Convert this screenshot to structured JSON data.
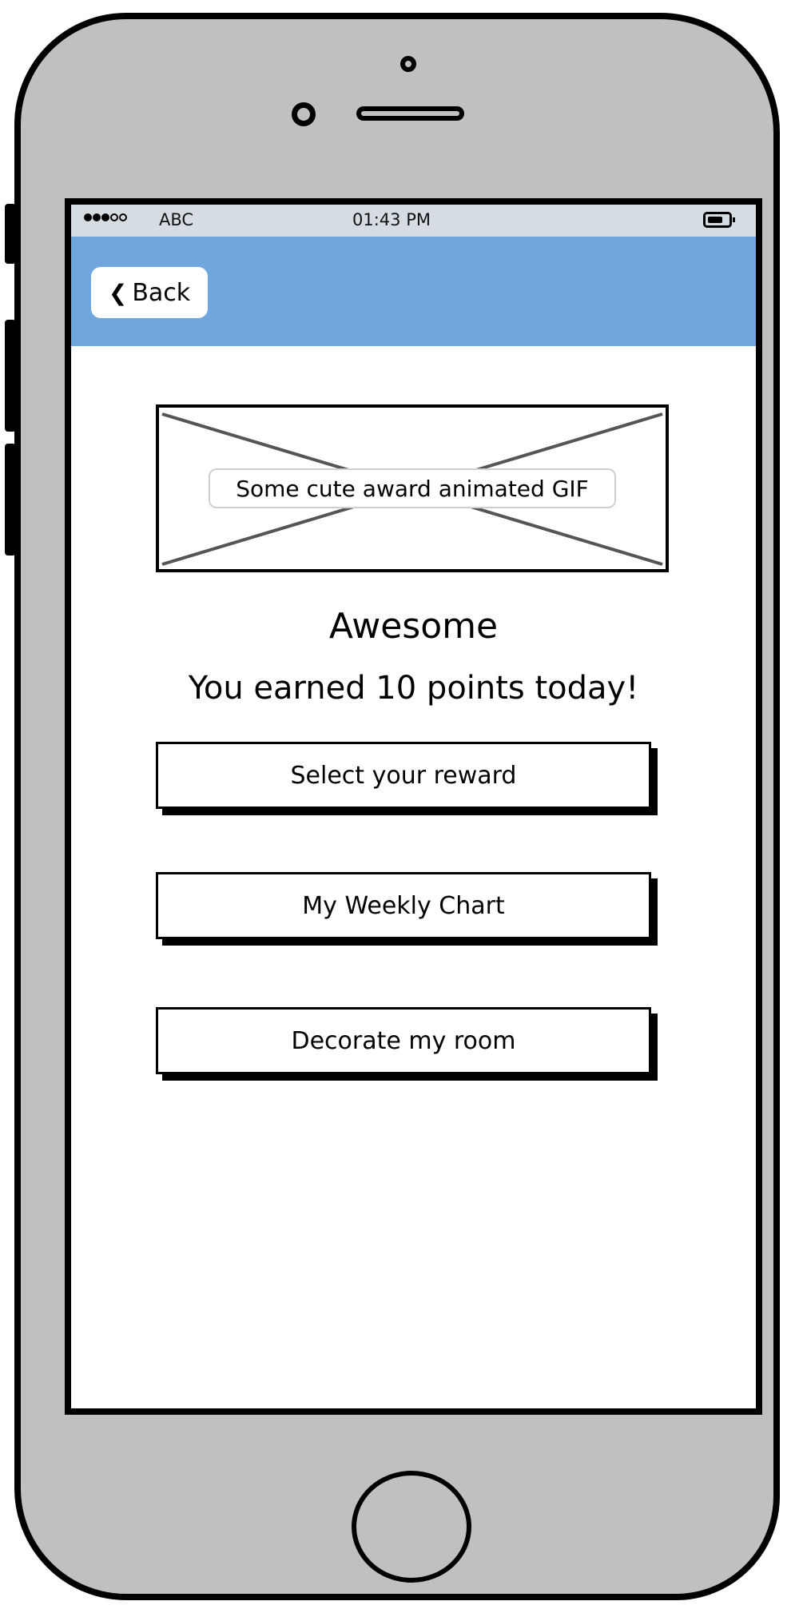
{
  "status_bar": {
    "carrier": "ABC",
    "time": "01:43 PM",
    "signal_bars_filled": 3,
    "signal_bars_total": 5
  },
  "nav": {
    "back_label": "Back",
    "back_icon": "chevron-left-icon"
  },
  "award_image": {
    "caption": "Some cute award animated GIF"
  },
  "main": {
    "title": "Awesome",
    "subtitle": "You earned 10 points today!"
  },
  "actions": {
    "select_reward": "Select your reward",
    "weekly_chart": "My Weekly Chart",
    "decorate_room": "Decorate my room"
  },
  "colors": {
    "nav_bar": "#6fa6dc",
    "status_bar": "#d6dde2",
    "phone_body": "#c0c0c0"
  }
}
